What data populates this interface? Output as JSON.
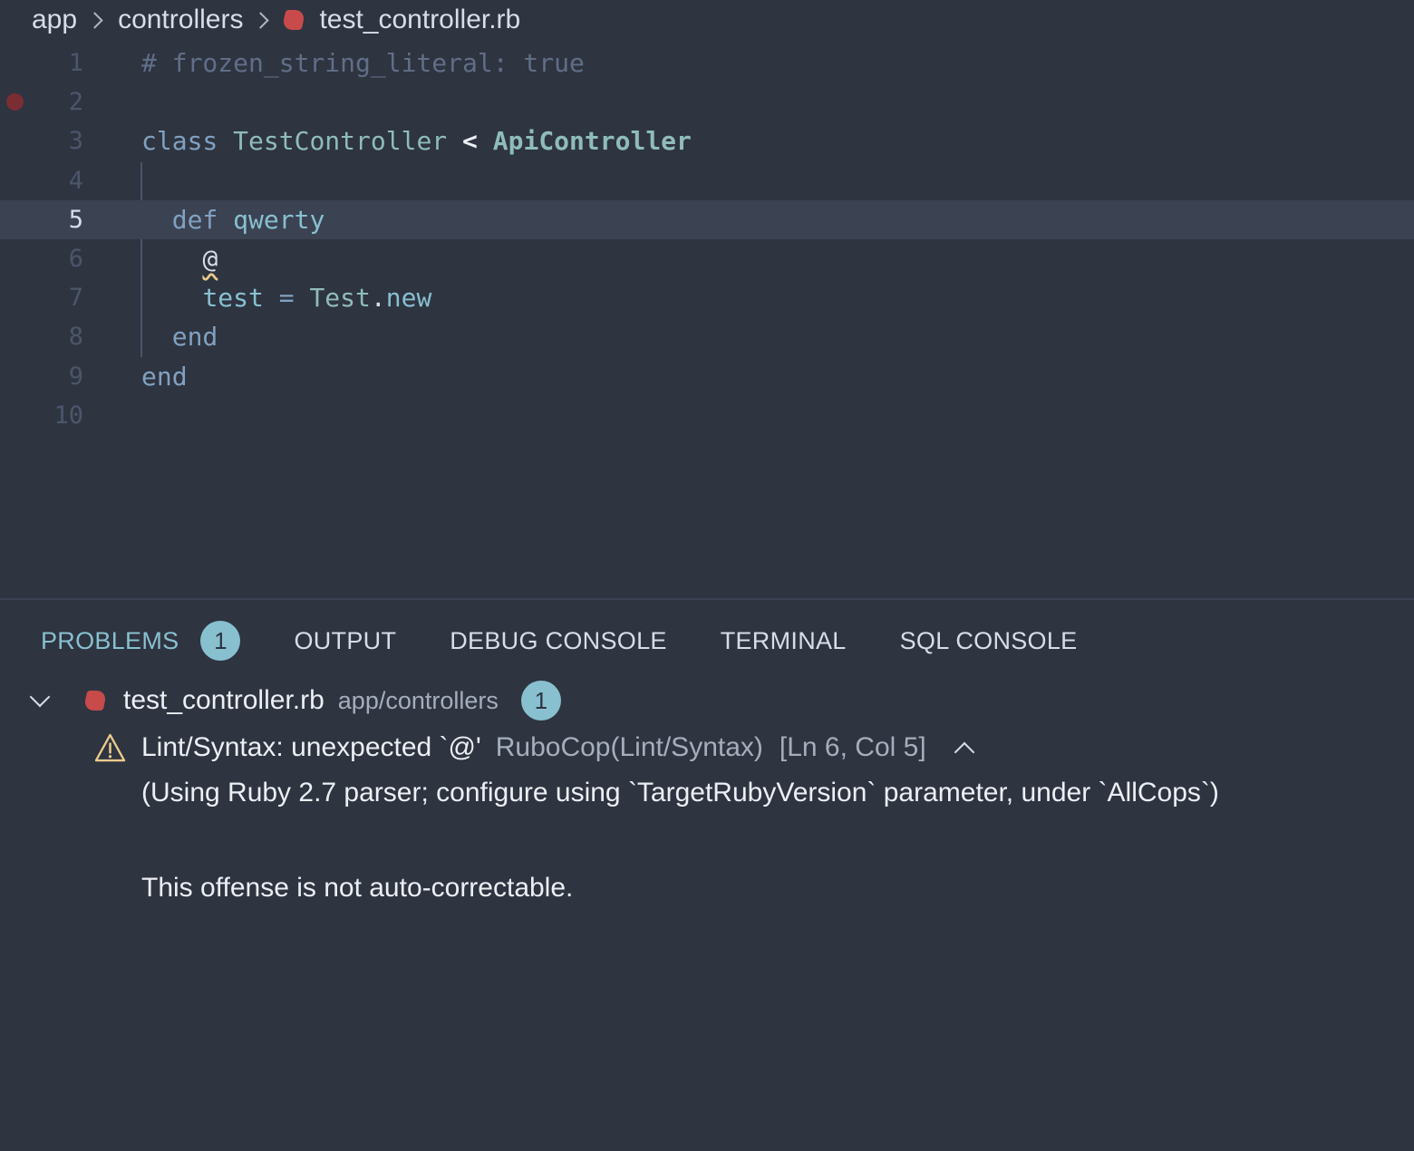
{
  "breadcrumb": {
    "items": [
      "app",
      "controllers"
    ],
    "file": "test_controller.rb",
    "file_icon": "ruby-icon"
  },
  "editor": {
    "current_line": 5,
    "breakpoint_line": 2,
    "lines": [
      {
        "number": "1",
        "text": "# frozen_string_literal: true"
      },
      {
        "number": "2",
        "text": ""
      },
      {
        "number": "3",
        "text": "class TestController < ApiController"
      },
      {
        "number": "4",
        "text": ""
      },
      {
        "number": "5",
        "text": "  def qwerty"
      },
      {
        "number": "6",
        "text": "    @"
      },
      {
        "number": "7",
        "text": "    test = Test.new"
      },
      {
        "number": "8",
        "text": "  end"
      },
      {
        "number": "9",
        "text": "end"
      },
      {
        "number": "10",
        "text": ""
      }
    ],
    "tokens": {
      "l1_comment": "# frozen_string_literal: true",
      "l3_class_kw": "class",
      "l3_class_name": "TestController",
      "l3_op": "<",
      "l3_parent": "ApiController",
      "l5_def": "def",
      "l5_name": "qwerty",
      "l6_err": "@",
      "l7_var": "test",
      "l7_eq": "=",
      "l7_const": "Test",
      "l7_dot": ".",
      "l7_method": "new",
      "l8_end": "end",
      "l9_end": "end"
    }
  },
  "panel": {
    "tabs": [
      {
        "label": "PROBLEMS",
        "active": true,
        "badge": "1"
      },
      {
        "label": "OUTPUT"
      },
      {
        "label": "DEBUG CONSOLE"
      },
      {
        "label": "TERMINAL"
      },
      {
        "label": "SQL CONSOLE"
      }
    ],
    "file_group": {
      "name": "test_controller.rb",
      "path": "app/controllers",
      "count": "1"
    },
    "problem": {
      "severity_icon": "warning-icon",
      "message": "Lint/Syntax: unexpected `@'",
      "source": "RuboCop(Lint/Syntax)",
      "location": "[Ln 6, Col 5]",
      "detail_line1": "(Using Ruby 2.7 parser; configure using `TargetRubyVersion` parameter, under `AllCops`)",
      "detail_line2": "This offense is not auto-correctable."
    }
  },
  "colors": {
    "background": "#2e3440",
    "current_line": "#3b4252",
    "accent": "#88c0d0",
    "ruby": "#c84a4a",
    "warning": "#ebcb8b"
  }
}
